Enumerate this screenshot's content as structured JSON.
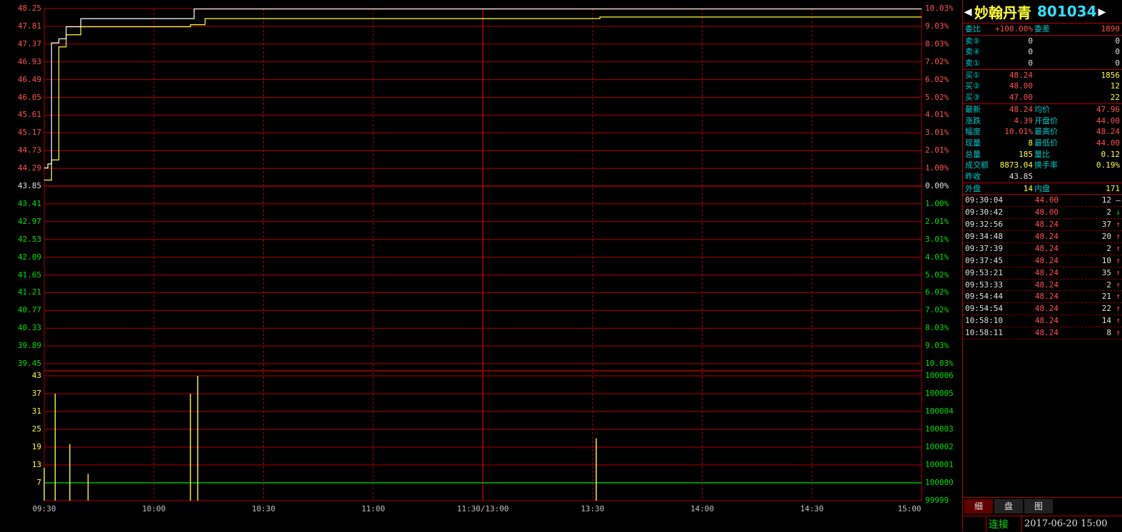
{
  "stock": {
    "name": "妙翰丹青",
    "code": "801034",
    "prev_arrow": "◀",
    "next_arrow": "▶"
  },
  "price_axis": {
    "left": [
      "48.25",
      "47.81",
      "47.37",
      "46.93",
      "46.49",
      "46.05",
      "45.61",
      "45.17",
      "44.73",
      "44.29",
      "43.85",
      "43.41",
      "42.97",
      "42.53",
      "42.09",
      "41.65",
      "41.21",
      "40.77",
      "40.33",
      "39.89",
      "39.45"
    ],
    "right": [
      "10.03%",
      "9.03%",
      "8.03%",
      "7.02%",
      "6.02%",
      "5.02%",
      "4.01%",
      "3.01%",
      "2.01%",
      "1.00%",
      "0.00%",
      "1.00%",
      "2.01%",
      "3.01%",
      "4.01%",
      "5.02%",
      "6.02%",
      "7.02%",
      "8.03%",
      "9.03%",
      "10.03%"
    ]
  },
  "volume_axis": {
    "left": [
      "43",
      "37",
      "31",
      "25",
      "19",
      "13",
      "7"
    ],
    "right": [
      "100006",
      "100005",
      "100004",
      "100003",
      "100002",
      "100001",
      "100000",
      "99999"
    ]
  },
  "time_axis": [
    "09:30",
    "10:00",
    "10:30",
    "11:00",
    "11:30/13:00",
    "13:30",
    "14:00",
    "14:30",
    "15:00"
  ],
  "colors": {
    "up": "#ff5050",
    "down": "#00e000",
    "grid": "#b00000",
    "price_line": "#ffffff",
    "avg_line": "#ffff30",
    "volume": "#ffff30",
    "flat": "#e0e0e0"
  },
  "chart_data": {
    "type": "line",
    "series": [
      {
        "values": [
          [
            0,
            44.3
          ],
          [
            1,
            44.4
          ],
          [
            2,
            47.4
          ],
          [
            4,
            47.5
          ],
          [
            6,
            47.8
          ],
          [
            10,
            48.0
          ],
          [
            40,
            48.0
          ],
          [
            41,
            48.24
          ],
          [
            240,
            48.24
          ]
        ]
      },
      {
        "values": [
          [
            0,
            44.0
          ],
          [
            2,
            44.5
          ],
          [
            4,
            47.3
          ],
          [
            6,
            47.6
          ],
          [
            10,
            47.8
          ],
          [
            40,
            47.85
          ],
          [
            44,
            48.0
          ],
          [
            150,
            48.0
          ],
          [
            152,
            48.04
          ],
          [
            240,
            48.04
          ]
        ]
      }
    ],
    "volume": [
      [
        0,
        12
      ],
      [
        3,
        37
      ],
      [
        7,
        20
      ],
      [
        12,
        10
      ],
      [
        40,
        37
      ],
      [
        42,
        43
      ],
      [
        151,
        22
      ]
    ],
    "volume_baseline": 100000,
    "ylim": [
      39.45,
      48.25
    ],
    "xlim": [
      0,
      240
    ]
  },
  "quote": {
    "weibi_label": "委比",
    "weibi": "+100.00%",
    "weicha_label": "委差",
    "weicha": "1890",
    "sell": [
      {
        "label": "卖⑤",
        "price": "0",
        "vol": "0"
      },
      {
        "label": "卖④",
        "price": "0",
        "vol": "0"
      },
      {
        "label": "卖①",
        "price": "0",
        "vol": "0"
      }
    ],
    "buy": [
      {
        "label": "买①",
        "price": "48.24",
        "vol": "1856"
      },
      {
        "label": "买②",
        "price": "48.00",
        "vol": "12"
      },
      {
        "label": "买③",
        "price": "47.00",
        "vol": "22"
      }
    ],
    "stats": [
      {
        "l1": "最新",
        "v1": "48.24",
        "c1": "red",
        "l2": "均价",
        "v2": "47.96",
        "c2": "red"
      },
      {
        "l1": "涨跌",
        "v1": "4.39",
        "c1": "red",
        "l2": "开盘价",
        "v2": "44.00",
        "c2": "red"
      },
      {
        "l1": "幅度",
        "v1": "10.01%",
        "c1": "red",
        "l2": "最高价",
        "v2": "48.24",
        "c2": "red"
      },
      {
        "l1": "现量",
        "v1": "8",
        "c1": "yellow",
        "l2": "最低价",
        "v2": "44.00",
        "c2": "red"
      },
      {
        "l1": "总量",
        "v1": "185",
        "c1": "yellow",
        "l2": "量比",
        "v2": "0.12",
        "c2": "yellow"
      },
      {
        "l1": "成交额",
        "v1": "8873.04",
        "c1": "yellow",
        "l2": "换手率",
        "v2": "0.19%",
        "c2": "yellow"
      },
      {
        "l1": "昨收",
        "v1": "43.85",
        "c1": "white",
        "l2": "",
        "v2": "",
        "c2": "white"
      }
    ],
    "waipan_label": "外盘",
    "waipan": "14",
    "neipan_label": "内盘",
    "neipan": "171"
  },
  "trades": [
    {
      "time": "09:30:04",
      "price": "44.00",
      "vol": "12",
      "dir": "—",
      "dc": "white"
    },
    {
      "time": "09:30:42",
      "price": "48.00",
      "vol": "2",
      "dir": "↓",
      "dc": "green"
    },
    {
      "time": "09:32:56",
      "price": "48.24",
      "vol": "37",
      "dir": "↑",
      "dc": "red"
    },
    {
      "time": "09:34:48",
      "price": "48.24",
      "vol": "20",
      "dir": "↑",
      "dc": "red"
    },
    {
      "time": "09:37:39",
      "price": "48.24",
      "vol": "2",
      "dir": "↑",
      "dc": "red"
    },
    {
      "time": "09:37:45",
      "price": "48.24",
      "vol": "10",
      "dir": "↑",
      "dc": "red"
    },
    {
      "time": "09:53:21",
      "price": "48.24",
      "vol": "35",
      "dir": "↑",
      "dc": "red"
    },
    {
      "time": "09:53:33",
      "price": "48.24",
      "vol": "2",
      "dir": "↑",
      "dc": "red"
    },
    {
      "time": "09:54:44",
      "price": "48.24",
      "vol": "21",
      "dir": "↑",
      "dc": "red"
    },
    {
      "time": "09:54:54",
      "price": "48.24",
      "vol": "22",
      "dir": "↑",
      "dc": "red"
    },
    {
      "time": "10:58:10",
      "price": "48.24",
      "vol": "14",
      "dir": "↑",
      "dc": "red"
    },
    {
      "time": "10:58:11",
      "price": "48.24",
      "vol": "8",
      "dir": "↑",
      "dc": "red"
    }
  ],
  "tabs": [
    "细",
    "盘",
    "图"
  ],
  "status": {
    "connection": "连接",
    "datetime": "2017-06-20 15:00"
  }
}
